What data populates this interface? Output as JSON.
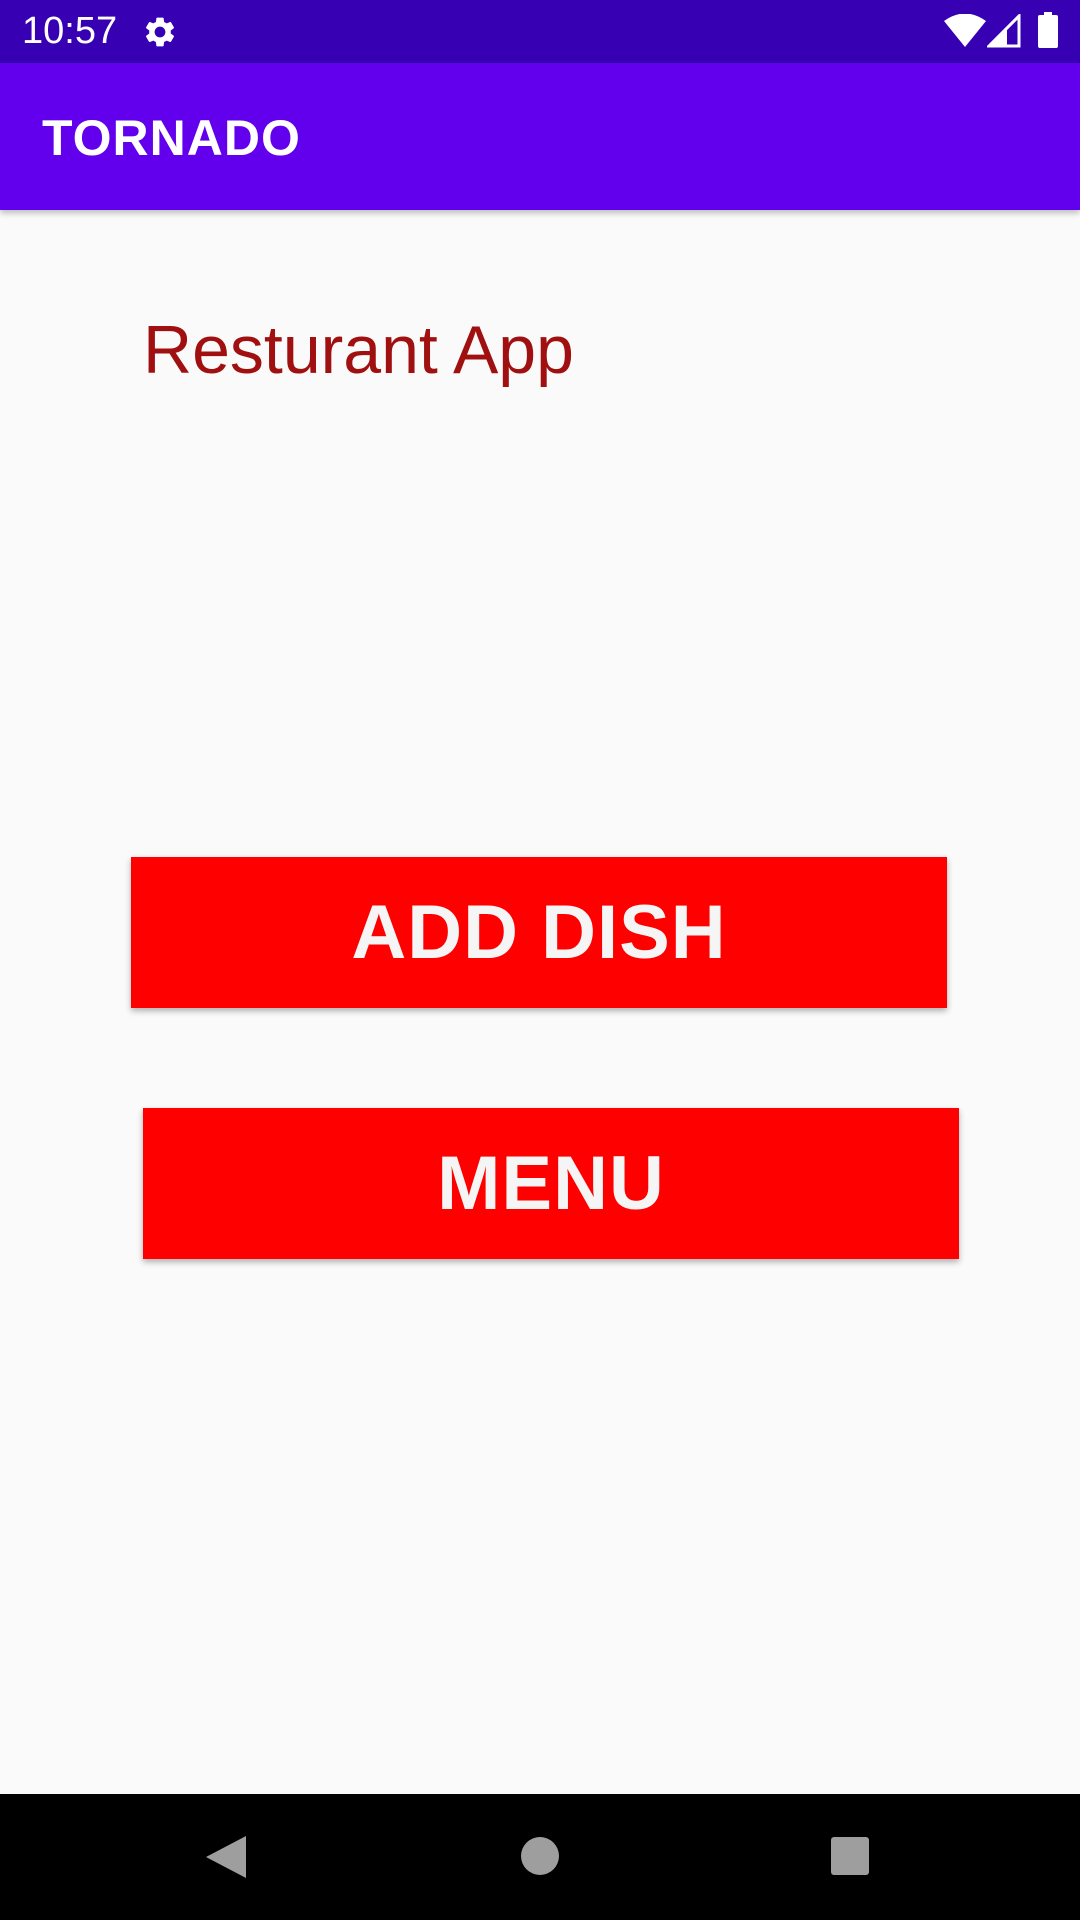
{
  "status_bar": {
    "time": "10:57",
    "icons": [
      "gear-icon",
      "wifi-icon",
      "signal-icon",
      "battery-icon"
    ]
  },
  "app_bar": {
    "title": "TORNADO",
    "background_color": "#6200ee"
  },
  "main": {
    "heading": "Resturant App",
    "heading_color": "#a01010",
    "buttons": {
      "add_dish": "ADD DISH",
      "menu": "MENU"
    },
    "button_color": "#ff0000"
  },
  "nav_bar": {
    "icons": [
      "back-icon",
      "home-icon",
      "recents-icon"
    ]
  }
}
